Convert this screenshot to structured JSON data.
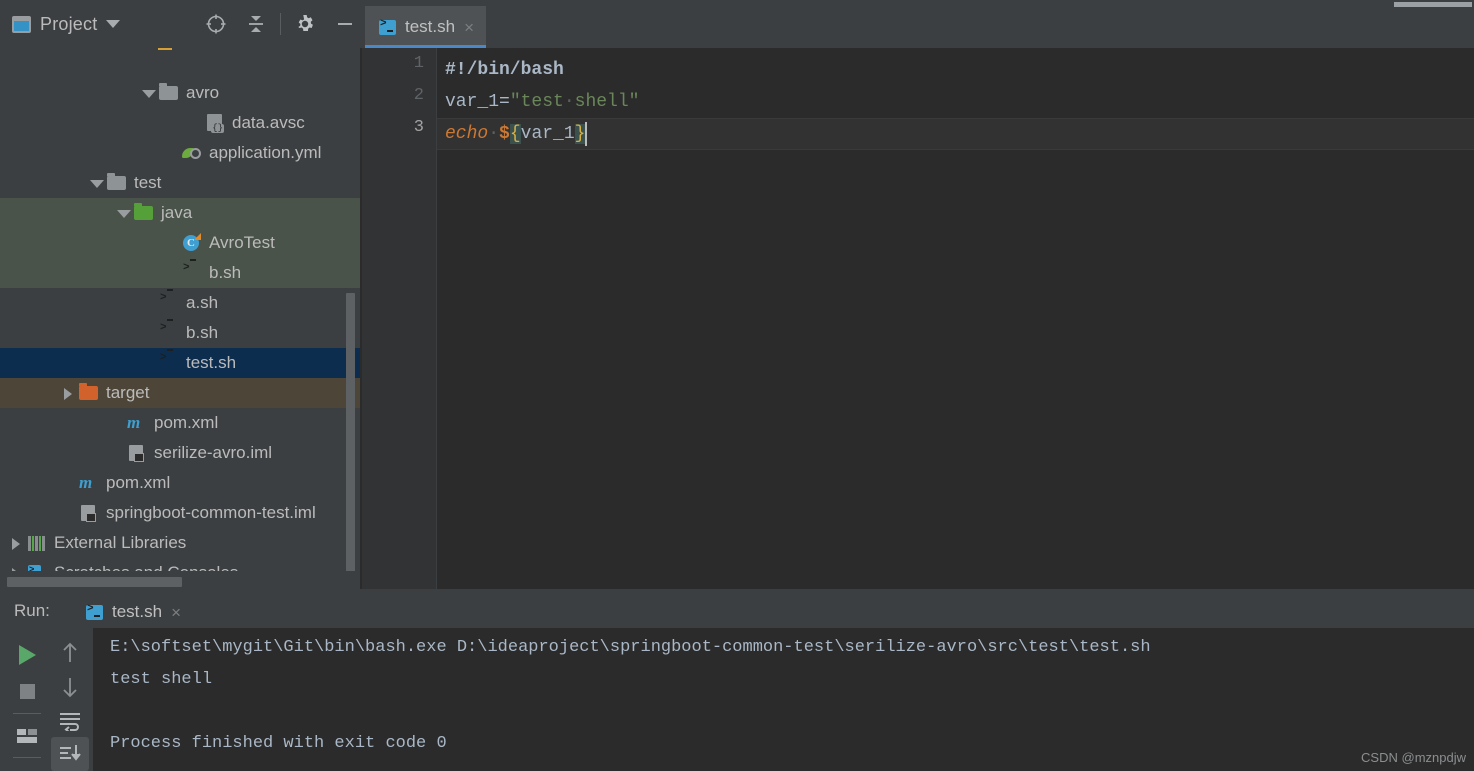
{
  "window": {
    "theme_bg": "#3c3f41",
    "editor_bg": "#2b2b2b",
    "accent_blue": "#4a88c7"
  },
  "project_toolbar": {
    "title": "Project",
    "icons": [
      {
        "name": "project-view-icon",
        "glyph": "square"
      },
      {
        "name": "chevron-down-icon",
        "glyph": "caret"
      },
      {
        "name": "locate-file-icon",
        "glyph": "crosshair"
      },
      {
        "name": "collapse-all-icon",
        "glyph": "collapse"
      },
      {
        "name": "settings-gear-icon",
        "glyph": "gear"
      },
      {
        "name": "hide-panel-icon",
        "glyph": "minus"
      }
    ]
  },
  "editor_tabs": {
    "active_tab": "test.sh",
    "close_glyph": "×"
  },
  "tree": {
    "rows": [
      {
        "label": "",
        "icon": "partial-cutoff-icon",
        "indent": 140,
        "arrow": "none",
        "state": "none",
        "partial": true
      },
      {
        "label": "avro",
        "icon": "folder-gray-icon",
        "indent": 140,
        "arrow": "down",
        "state": "none"
      },
      {
        "label": "data.avsc",
        "icon": "avsc-file-icon",
        "indent": 186,
        "arrow": "none",
        "state": "none"
      },
      {
        "label": "application.yml",
        "icon": "yaml-file-icon",
        "indent": 163,
        "arrow": "none",
        "state": "none"
      },
      {
        "label": "test",
        "icon": "folder-gray-icon",
        "indent": 88,
        "arrow": "down",
        "state": "none"
      },
      {
        "label": "java",
        "icon": "folder-green-icon",
        "indent": 115,
        "arrow": "down",
        "state": "green"
      },
      {
        "label": "AvroTest",
        "icon": "java-class-icon",
        "indent": 163,
        "arrow": "none",
        "state": "green"
      },
      {
        "label": "b.sh",
        "icon": "shell-file-icon",
        "indent": 163,
        "arrow": "none",
        "state": "green"
      },
      {
        "label": "a.sh",
        "icon": "shell-file-icon",
        "indent": 140,
        "arrow": "none",
        "state": "none"
      },
      {
        "label": "b.sh",
        "icon": "shell-file-icon",
        "indent": 140,
        "arrow": "none",
        "state": "none"
      },
      {
        "label": "test.sh",
        "icon": "shell-file-icon",
        "indent": 140,
        "arrow": "none",
        "state": "selected"
      },
      {
        "label": "target",
        "icon": "folder-orange-icon",
        "indent": 60,
        "arrow": "right",
        "state": "olive"
      },
      {
        "label": "pom.xml",
        "icon": "maven-file-icon",
        "indent": 108,
        "arrow": "none",
        "state": "none"
      },
      {
        "label": "serilize-avro.iml",
        "icon": "iml-file-icon",
        "indent": 108,
        "arrow": "none",
        "state": "none"
      },
      {
        "label": "pom.xml",
        "icon": "maven-file-icon",
        "indent": 60,
        "arrow": "none",
        "state": "none"
      },
      {
        "label": "springboot-common-test.iml",
        "icon": "iml-file-icon",
        "indent": 60,
        "arrow": "none",
        "state": "none"
      },
      {
        "label": "External Libraries",
        "icon": "libraries-icon",
        "indent": 8,
        "arrow": "right",
        "state": "none"
      },
      {
        "label": "Scratches and Consoles",
        "icon": "scratches-icon",
        "indent": 8,
        "arrow": "right",
        "state": "none"
      }
    ]
  },
  "editor": {
    "line_numbers": [
      "1",
      "2",
      "3"
    ],
    "current_line": 3,
    "lines": [
      {
        "num": "1",
        "tokens": [
          {
            "t": "#!/bin/bash",
            "c": "shebang"
          }
        ]
      },
      {
        "num": "2",
        "tokens": [
          {
            "t": "var_1=",
            "c": "plain"
          },
          {
            "t": "\"test",
            "c": "str"
          },
          {
            "t": "·",
            "c": "dot"
          },
          {
            "t": "shell\"",
            "c": "str"
          }
        ]
      },
      {
        "num": "3",
        "tokens": [
          {
            "t": "echo",
            "c": "kw"
          },
          {
            "t": "·",
            "c": "dot"
          },
          {
            "t": "$",
            "c": "dollar"
          },
          {
            "t": "{",
            "c": "brace"
          },
          {
            "t": "var_1",
            "c": "var"
          },
          {
            "t": "}",
            "c": "brace"
          }
        ]
      }
    ]
  },
  "run_panel": {
    "label": "Run:",
    "tab_name": "test.sh",
    "close_glyph": "×",
    "toolbar_left": [
      {
        "name": "rerun-button",
        "glyph": "play"
      },
      {
        "name": "stop-button",
        "glyph": "stop"
      },
      {
        "name": "layout-settings-button",
        "glyph": "layout"
      }
    ],
    "toolbar_right": [
      {
        "name": "previous-occurrence-button",
        "glyph": "↑"
      },
      {
        "name": "next-occurrence-button",
        "glyph": "↓"
      },
      {
        "name": "soft-wrap-button",
        "glyph": "wrap"
      },
      {
        "name": "scroll-to-end-button",
        "glyph": "scroll-end"
      }
    ],
    "console_lines": [
      "E:\\softset\\mygit\\Git\\bin\\bash.exe D:\\ideaproject\\springboot-common-test\\serilize-avro\\src\\test\\test.sh",
      "test shell",
      "",
      "Process finished with exit code 0"
    ]
  },
  "watermark": "CSDN @mznpdjw"
}
